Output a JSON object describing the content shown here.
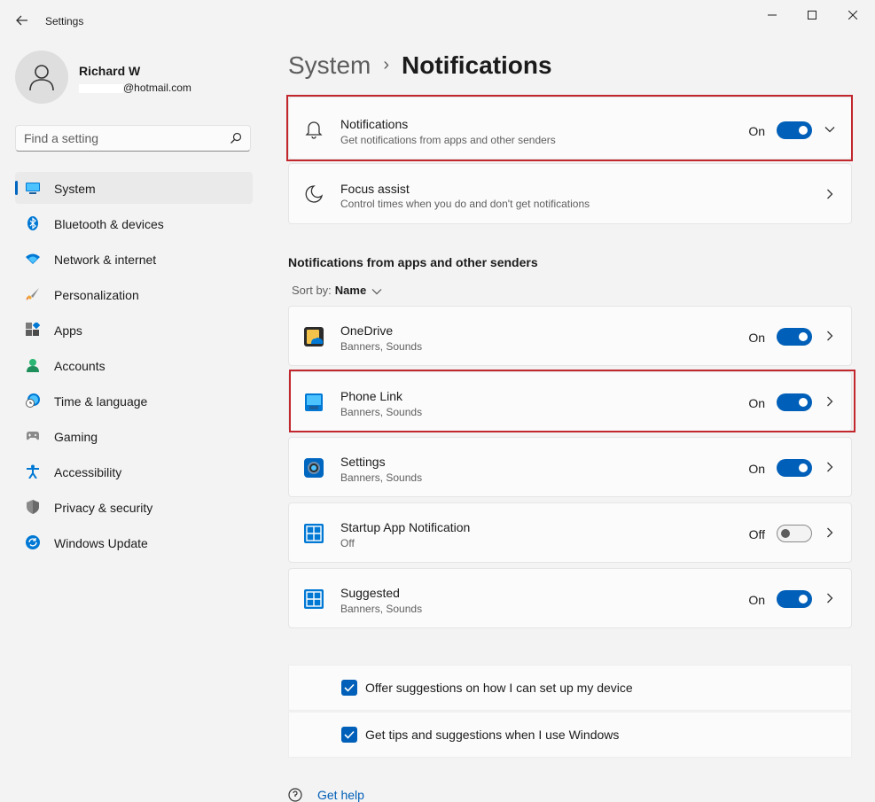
{
  "window": {
    "title": "Settings"
  },
  "profile": {
    "name": "Richard W",
    "email": "@hotmail.com"
  },
  "search": {
    "placeholder": "Find a setting"
  },
  "sidebar": {
    "items": [
      {
        "label": "System",
        "icon": "monitor-icon",
        "active": true
      },
      {
        "label": "Bluetooth & devices",
        "icon": "bluetooth-icon"
      },
      {
        "label": "Network & internet",
        "icon": "wifi-icon"
      },
      {
        "label": "Personalization",
        "icon": "brush-icon"
      },
      {
        "label": "Apps",
        "icon": "apps-icon"
      },
      {
        "label": "Accounts",
        "icon": "person-icon"
      },
      {
        "label": "Time & language",
        "icon": "globe-clock-icon"
      },
      {
        "label": "Gaming",
        "icon": "gamepad-icon"
      },
      {
        "label": "Accessibility",
        "icon": "accessibility-icon"
      },
      {
        "label": "Privacy & security",
        "icon": "shield-icon"
      },
      {
        "label": "Windows Update",
        "icon": "update-icon"
      }
    ]
  },
  "breadcrumb": {
    "parent": "System",
    "separator": "›",
    "current": "Notifications"
  },
  "notifications_card": {
    "title": "Notifications",
    "subtitle": "Get notifications from apps and other senders",
    "state": "On",
    "toggle_on": true
  },
  "focus_card": {
    "title": "Focus assist",
    "subtitle": "Control times when you do and don't get notifications"
  },
  "section": {
    "heading": "Notifications from apps and other senders",
    "sort_label": "Sort by:",
    "sort_value": "Name"
  },
  "apps": [
    {
      "name": "OneDrive",
      "detail": "Banners, Sounds",
      "state": "On",
      "toggle_on": true,
      "icon": "onedrive-icon"
    },
    {
      "name": "Phone Link",
      "detail": "Banners, Sounds",
      "state": "On",
      "toggle_on": true,
      "icon": "phone-link-icon"
    },
    {
      "name": "Settings",
      "detail": "Banners, Sounds",
      "state": "On",
      "toggle_on": true,
      "icon": "settings-gear-icon"
    },
    {
      "name": "Startup App Notification",
      "detail": "Off",
      "state": "Off",
      "toggle_on": false,
      "icon": "startup-app-icon"
    },
    {
      "name": "Suggested",
      "detail": "Banners, Sounds",
      "state": "On",
      "toggle_on": true,
      "icon": "suggested-icon"
    }
  ],
  "checks": [
    {
      "label": "Offer suggestions on how I can set up my device",
      "checked": true
    },
    {
      "label": "Get tips and suggestions when I use Windows",
      "checked": true
    }
  ],
  "help": {
    "label": "Get help"
  },
  "colors": {
    "accent": "#005fb8",
    "highlight": "#c1272d",
    "background": "#f3f3f3",
    "card": "#fbfbfb"
  }
}
